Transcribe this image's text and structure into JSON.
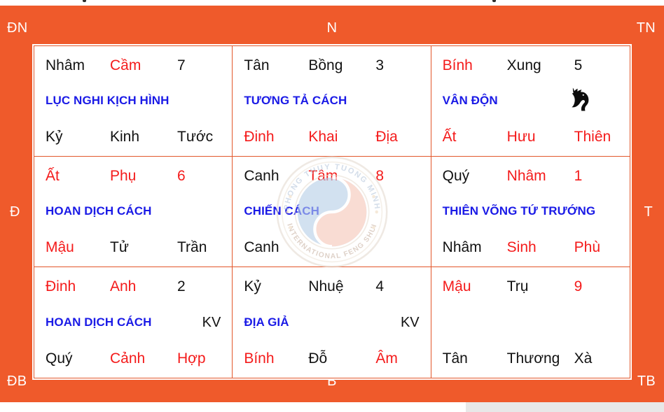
{
  "theme": {
    "field_color": "#ef5a2b",
    "grid_line_color": "#e2572b",
    "cell_bg": "#ffffff",
    "red": "#f41b1b",
    "black": "#121212",
    "pattern_blue": "#1a1ae6",
    "direction_label_color": "#ffffff"
  },
  "directions": {
    "top_left": "ĐN",
    "top_center": "N",
    "top_right": "TN",
    "middle_left": "Đ",
    "middle_right": "T",
    "bottom_left": "ĐB",
    "bottom_center": "B",
    "bottom_right": "TB"
  },
  "watermark": {
    "icon": "yin-yang-seal-icon",
    "outer_text": "PHONG THUY TUONG MINH",
    "inner_text": "INTERNATIONAL FENG SHUI",
    "yin_color": "#b7cfe8",
    "yang_color": "#f6c7b9"
  },
  "icons": {
    "horse": "horse-head-icon"
  },
  "cells": [
    {
      "id": "cell-dn",
      "palace": "7",
      "top": [
        {
          "text": "Nhâm",
          "color": "black"
        },
        {
          "text": "Cầm",
          "color": "red"
        },
        {
          "text": "7",
          "color": "black"
        }
      ],
      "pattern": "LỤC NGHI KỊCH HÌNH",
      "kv": "",
      "bottom": [
        {
          "text": "Kỷ",
          "color": "black"
        },
        {
          "text": "Kinh",
          "color": "black"
        },
        {
          "text": "Tước",
          "color": "black"
        }
      ],
      "has_horse": false
    },
    {
      "id": "cell-n",
      "palace": "3",
      "top": [
        {
          "text": "Tân",
          "color": "black"
        },
        {
          "text": "Bồng",
          "color": "black"
        },
        {
          "text": "3",
          "color": "black"
        }
      ],
      "pattern": "TƯƠNG TẢ CÁCH",
      "kv": "",
      "bottom": [
        {
          "text": "Đinh",
          "color": "red"
        },
        {
          "text": "Khai",
          "color": "red"
        },
        {
          "text": "Địa",
          "color": "red"
        }
      ],
      "has_horse": false
    },
    {
      "id": "cell-tn",
      "palace": "5",
      "top": [
        {
          "text": "Bính",
          "color": "red"
        },
        {
          "text": "Xung",
          "color": "black"
        },
        {
          "text": "5",
          "color": "black"
        }
      ],
      "pattern": "VÂN ĐỘN",
      "kv": "",
      "bottom": [
        {
          "text": "Ất",
          "color": "red"
        },
        {
          "text": "Hưu",
          "color": "red"
        },
        {
          "text": "Thiên",
          "color": "red"
        }
      ],
      "has_horse": true
    },
    {
      "id": "cell-d",
      "palace": "6",
      "top": [
        {
          "text": "Ất",
          "color": "red"
        },
        {
          "text": "Phụ",
          "color": "red"
        },
        {
          "text": "6",
          "color": "red"
        }
      ],
      "pattern": "HOAN DỊCH CÁCH",
      "kv": "",
      "bottom": [
        {
          "text": "Mậu",
          "color": "red"
        },
        {
          "text": "Tử",
          "color": "black"
        },
        {
          "text": "Trần",
          "color": "black"
        }
      ],
      "has_horse": false
    },
    {
      "id": "cell-center",
      "palace": "8",
      "top": [
        {
          "text": "Canh",
          "color": "black"
        },
        {
          "text": "Tâm",
          "color": "red"
        },
        {
          "text": "8",
          "color": "red"
        }
      ],
      "pattern": "CHIẾN CÁCH",
      "kv": "",
      "bottom": [
        {
          "text": "Canh",
          "color": "black"
        },
        {
          "text": "",
          "color": "black"
        },
        {
          "text": "",
          "color": "black"
        }
      ],
      "has_horse": false
    },
    {
      "id": "cell-t",
      "palace": "1",
      "top": [
        {
          "text": "Quý",
          "color": "black"
        },
        {
          "text": "Nhâm",
          "color": "red"
        },
        {
          "text": "1",
          "color": "red"
        }
      ],
      "pattern": "THIÊN VÕNG TỨ TRƯỚNG",
      "kv": "",
      "bottom": [
        {
          "text": "Nhâm",
          "color": "black"
        },
        {
          "text": "Sinh",
          "color": "red"
        },
        {
          "text": "Phù",
          "color": "red"
        }
      ],
      "has_horse": false
    },
    {
      "id": "cell-db",
      "palace": "2",
      "top": [
        {
          "text": "Đinh",
          "color": "red"
        },
        {
          "text": "Anh",
          "color": "red"
        },
        {
          "text": "2",
          "color": "black"
        }
      ],
      "pattern": "HOAN DỊCH CÁCH",
      "kv": "KV",
      "bottom": [
        {
          "text": "Quý",
          "color": "black"
        },
        {
          "text": "Cảnh",
          "color": "red"
        },
        {
          "text": "Hợp",
          "color": "red"
        }
      ],
      "has_horse": false
    },
    {
      "id": "cell-b",
      "palace": "4",
      "top": [
        {
          "text": "Kỷ",
          "color": "black"
        },
        {
          "text": "Nhuệ",
          "color": "black"
        },
        {
          "text": "4",
          "color": "black"
        }
      ],
      "pattern": "ĐỊA GIẢ",
      "kv": "KV",
      "bottom": [
        {
          "text": "Bính",
          "color": "red"
        },
        {
          "text": "Đỗ",
          "color": "black"
        },
        {
          "text": "Âm",
          "color": "red"
        }
      ],
      "has_horse": false
    },
    {
      "id": "cell-tb",
      "palace": "9",
      "top": [
        {
          "text": "Mậu",
          "color": "red"
        },
        {
          "text": "Trụ",
          "color": "black"
        },
        {
          "text": "9",
          "color": "red"
        }
      ],
      "pattern": "",
      "kv": "",
      "bottom": [
        {
          "text": "Tân",
          "color": "black"
        },
        {
          "text": "Thương",
          "color": "black"
        },
        {
          "text": "Xà",
          "color": "black"
        }
      ],
      "has_horse": false
    }
  ]
}
